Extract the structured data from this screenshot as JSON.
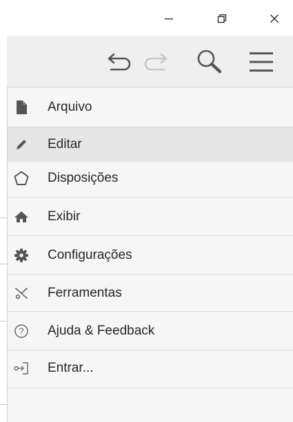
{
  "window": {
    "minimize_label": "—",
    "restore_label": "⧉",
    "close_label": "✕"
  },
  "toolbar": {
    "undo_icon": "undo-icon",
    "redo_icon": "redo-icon",
    "search_icon": "search-icon",
    "menu_icon": "hamburger-menu-icon"
  },
  "menu": {
    "items": [
      {
        "label": "Arquivo",
        "icon": "file-icon"
      },
      {
        "label": "Editar",
        "icon": "pencil-icon"
      },
      {
        "label": "Disposições",
        "icon": "layout-pentagon-icon"
      },
      {
        "label": "Exibir",
        "icon": "home-icon"
      },
      {
        "label": "Configurações",
        "icon": "gear-icon"
      },
      {
        "label": "Ferramentas",
        "icon": "scissors-icon"
      },
      {
        "label": "Ajuda & Feedback",
        "icon": "help-circle-icon"
      },
      {
        "label": "Entrar...",
        "icon": "sign-in-icon"
      }
    ]
  },
  "colors": {
    "toolbar_bg": "#efefef",
    "menu_bg": "#f6f6f6",
    "hover_bg": "#e6e6e6",
    "icon_dark": "#555555",
    "icon_disabled": "#c8c8c8"
  }
}
